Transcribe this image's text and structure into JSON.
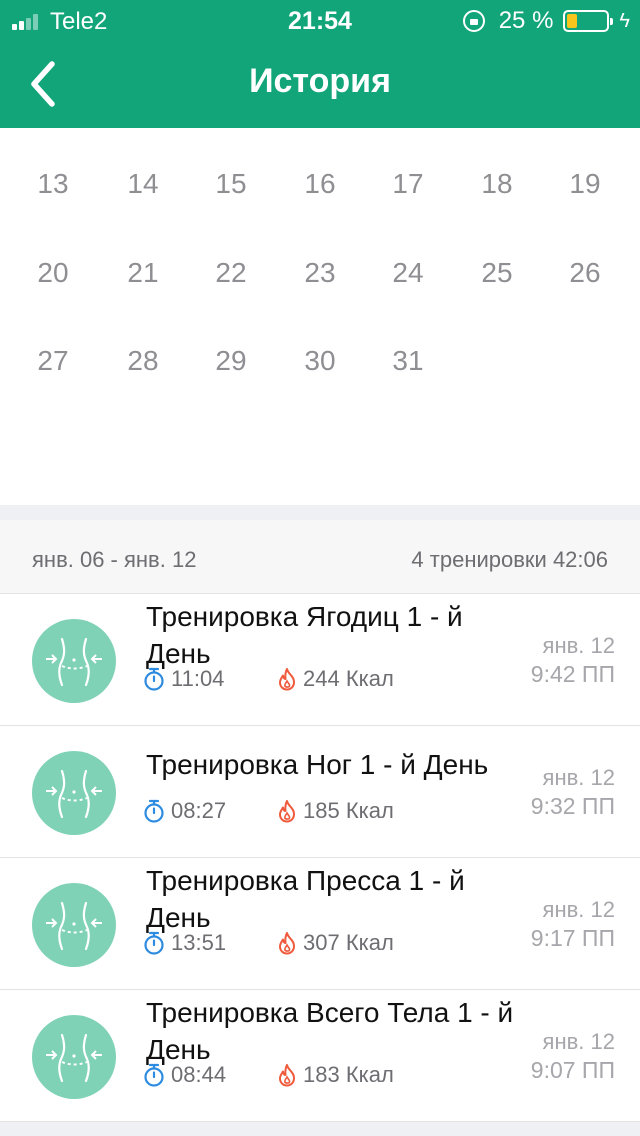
{
  "status_bar": {
    "carrier": "Tele2",
    "time": "21:54",
    "battery": "25 %"
  },
  "header": {
    "title": "История"
  },
  "calendar": {
    "rows": [
      [
        "13",
        "14",
        "15",
        "16",
        "17",
        "18",
        "19"
      ],
      [
        "20",
        "21",
        "22",
        "23",
        "24",
        "25",
        "26"
      ],
      [
        "27",
        "28",
        "29",
        "30",
        "31"
      ]
    ]
  },
  "week": {
    "range": "янв. 06 - янв. 12",
    "summary": "4 тренировки 42:06"
  },
  "workouts": [
    {
      "title": "Тренировка Ягодиц 1 - й День",
      "duration": "11:04",
      "calories": "244 Ккал",
      "date": "янв. 12",
      "time": "9:42 ПП"
    },
    {
      "title": "Тренировка Ног 1 - й День",
      "duration": "08:27",
      "calories": "185 Ккал",
      "date": "янв. 12",
      "time": "9:32 ПП"
    },
    {
      "title": "Тренировка Пресса 1 - й День",
      "duration": "13:51",
      "calories": "307 Ккал",
      "date": "янв. 12",
      "time": "9:17 ПП"
    },
    {
      "title": "Тренировка Всего Тела  1 - й День",
      "duration": "08:44",
      "calories": "183 Ккал",
      "date": "янв. 12",
      "time": "9:07 ПП"
    }
  ],
  "colors": {
    "brand": "#12a57a",
    "avatar": "#7fd2b5",
    "timer_icon": "#2d8be0",
    "flame_icon": "#f05a3c"
  },
  "icons": {
    "back": "chevron-left-icon",
    "workout": "waist-body-icon",
    "duration": "stopwatch-icon",
    "calories": "flame-icon"
  }
}
